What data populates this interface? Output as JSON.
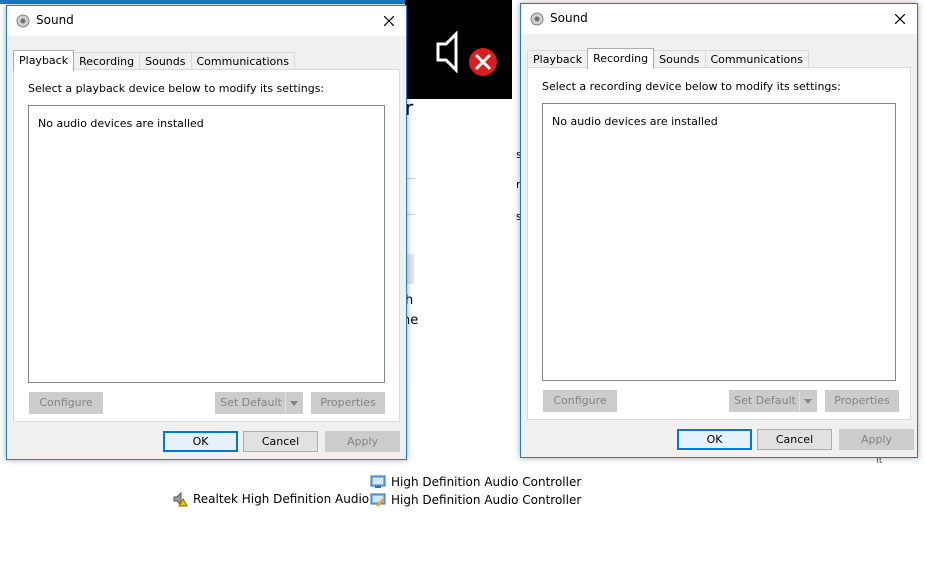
{
  "dialogs": {
    "playback": {
      "title": "Sound",
      "tabs": [
        "Playback",
        "Recording",
        "Sounds",
        "Communications"
      ],
      "active_tab": "Playback",
      "instruction": "Select a playback device below to modify its settings:",
      "empty_message": "No audio devices are installed",
      "buttons": {
        "configure": "Configure",
        "set_default": "Set Default",
        "properties": "Properties",
        "ok": "OK",
        "cancel": "Cancel",
        "apply": "Apply"
      }
    },
    "recording": {
      "title": "Sound",
      "tabs": [
        "Playback",
        "Recording",
        "Sounds",
        "Communications"
      ],
      "active_tab": "Recording",
      "instruction": "Select a recording device below to modify its settings:",
      "empty_message": "No audio devices are installed",
      "buttons": {
        "configure": "Configure",
        "set_default": "Set Default",
        "properties": "Properties",
        "ok": "OK",
        "cancel": "Cancel",
        "apply": "Apply"
      }
    }
  },
  "background": {
    "chars": [
      "r",
      "h",
      "he",
      "s",
      "s",
      "r"
    ],
    "right_fragment": "it"
  },
  "devices": [
    {
      "label": "High Definition Audio Controller",
      "icon": "audio-controller-icon"
    },
    {
      "label": "High Definition Audio Controller",
      "icon": "audio-controller-icon"
    },
    {
      "label": "Realtek High Definition Audio",
      "icon": "speaker-warning-icon"
    }
  ],
  "colors": {
    "accent": "#0078d7",
    "title_border": "#2b78c9",
    "mute_badge": "#d81e1e"
  }
}
